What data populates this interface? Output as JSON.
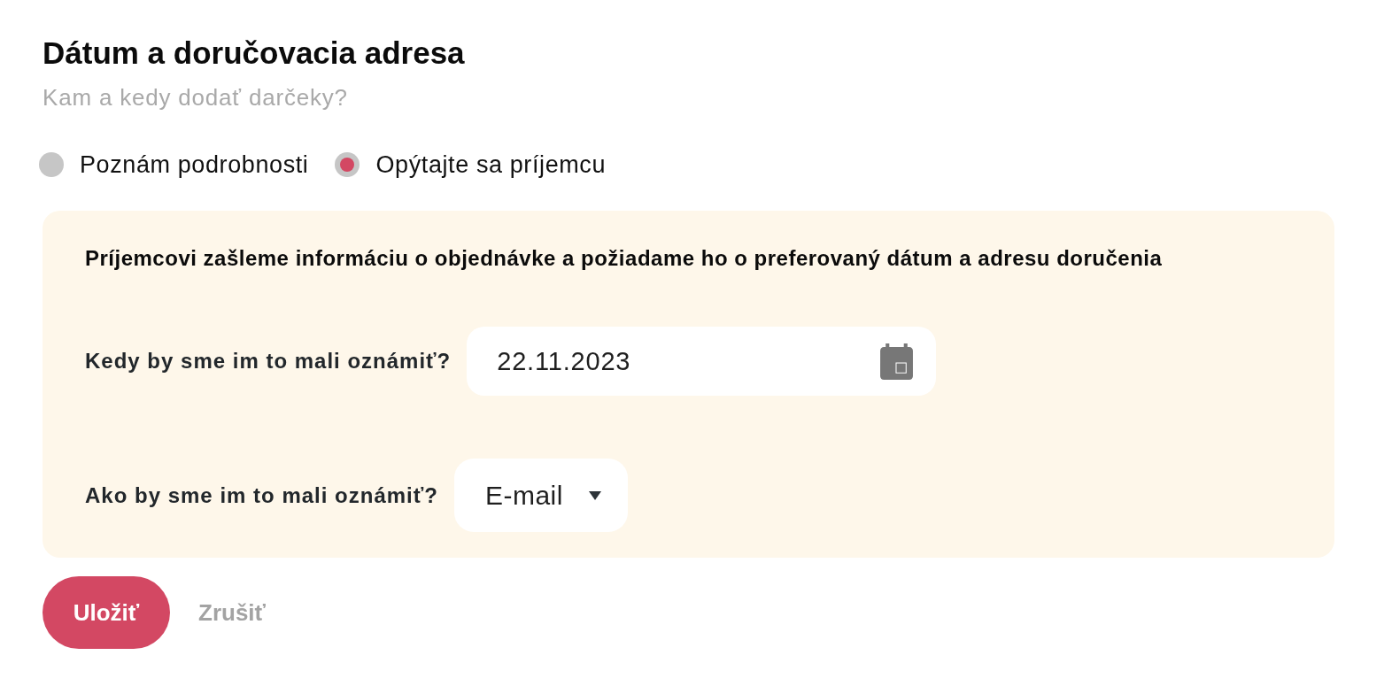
{
  "header": {
    "title": "Dátum a doručovacia adresa",
    "subtitle": "Kam a kedy dodať darčeky?"
  },
  "delivery_options": [
    {
      "label": "Poznám podrobnosti",
      "selected": false
    },
    {
      "label": "Opýtajte sa príjemcu",
      "selected": true
    }
  ],
  "info_panel": {
    "message": "Príjemcovi zašleme informáciu o objednávke a požiadame ho o preferovaný dátum a adresu doručenia",
    "fields": [
      {
        "kind": "date",
        "label": "Kedy by sme im to mali oznámiť?",
        "value": "22.11.2023"
      },
      {
        "kind": "select",
        "label": "Ako by sme im to mali oznámiť?",
        "value": "E-mail"
      }
    ]
  },
  "buttons": [
    {
      "kind": "primary",
      "label": "Uložiť"
    },
    {
      "kind": "secondary",
      "label": "Zrušiť"
    }
  ]
}
